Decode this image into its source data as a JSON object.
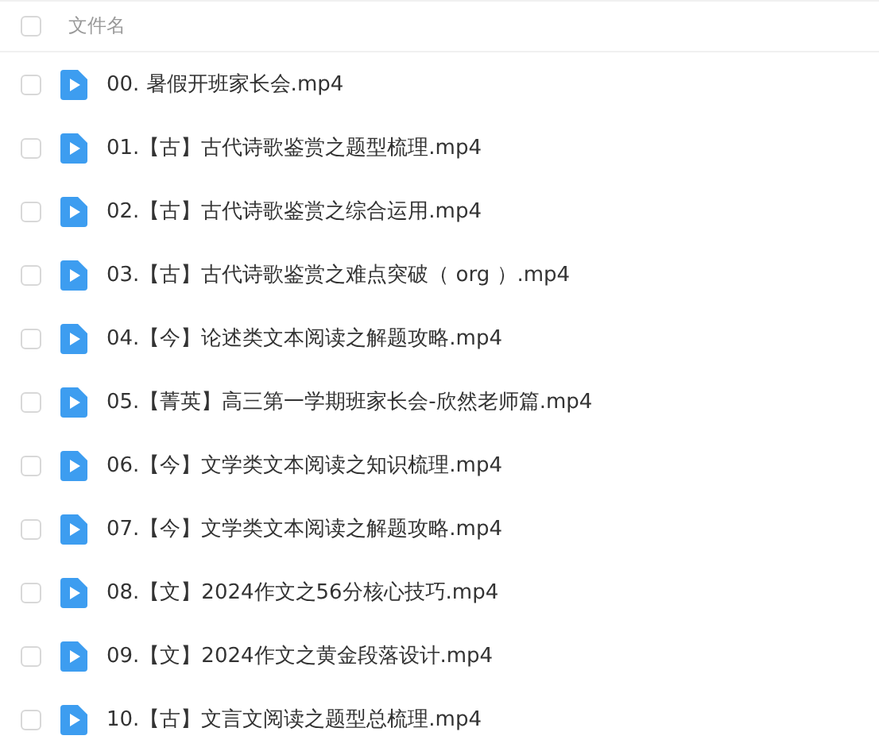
{
  "header": {
    "checked": false,
    "label": "文件名"
  },
  "files": [
    {
      "name": "00. 暑假开班家长会.mp4",
      "checked": false
    },
    {
      "name": "01.【古】古代诗歌鉴赏之题型梳理.mp4",
      "checked": false
    },
    {
      "name": "02.【古】古代诗歌鉴赏之综合运用.mp4",
      "checked": false
    },
    {
      "name": "03.【古】古代诗歌鉴赏之难点突破（ org ）.mp4",
      "checked": false
    },
    {
      "name": "04.【今】论述类文本阅读之解题攻略.mp4",
      "checked": false
    },
    {
      "name": "05.【菁英】高三第一学期班家长会-欣然老师篇.mp4",
      "checked": false
    },
    {
      "name": "06.【今】文学类文本阅读之知识梳理.mp4",
      "checked": false
    },
    {
      "name": "07.【今】文学类文本阅读之解题攻略.mp4",
      "checked": false
    },
    {
      "name": "08.【文】2024作文之56分核心技巧.mp4",
      "checked": false
    },
    {
      "name": "09.【文】2024作文之黄金段落设计.mp4",
      "checked": false
    },
    {
      "name": "10.【古】文言文阅读之题型总梳理.mp4",
      "checked": false
    }
  ]
}
